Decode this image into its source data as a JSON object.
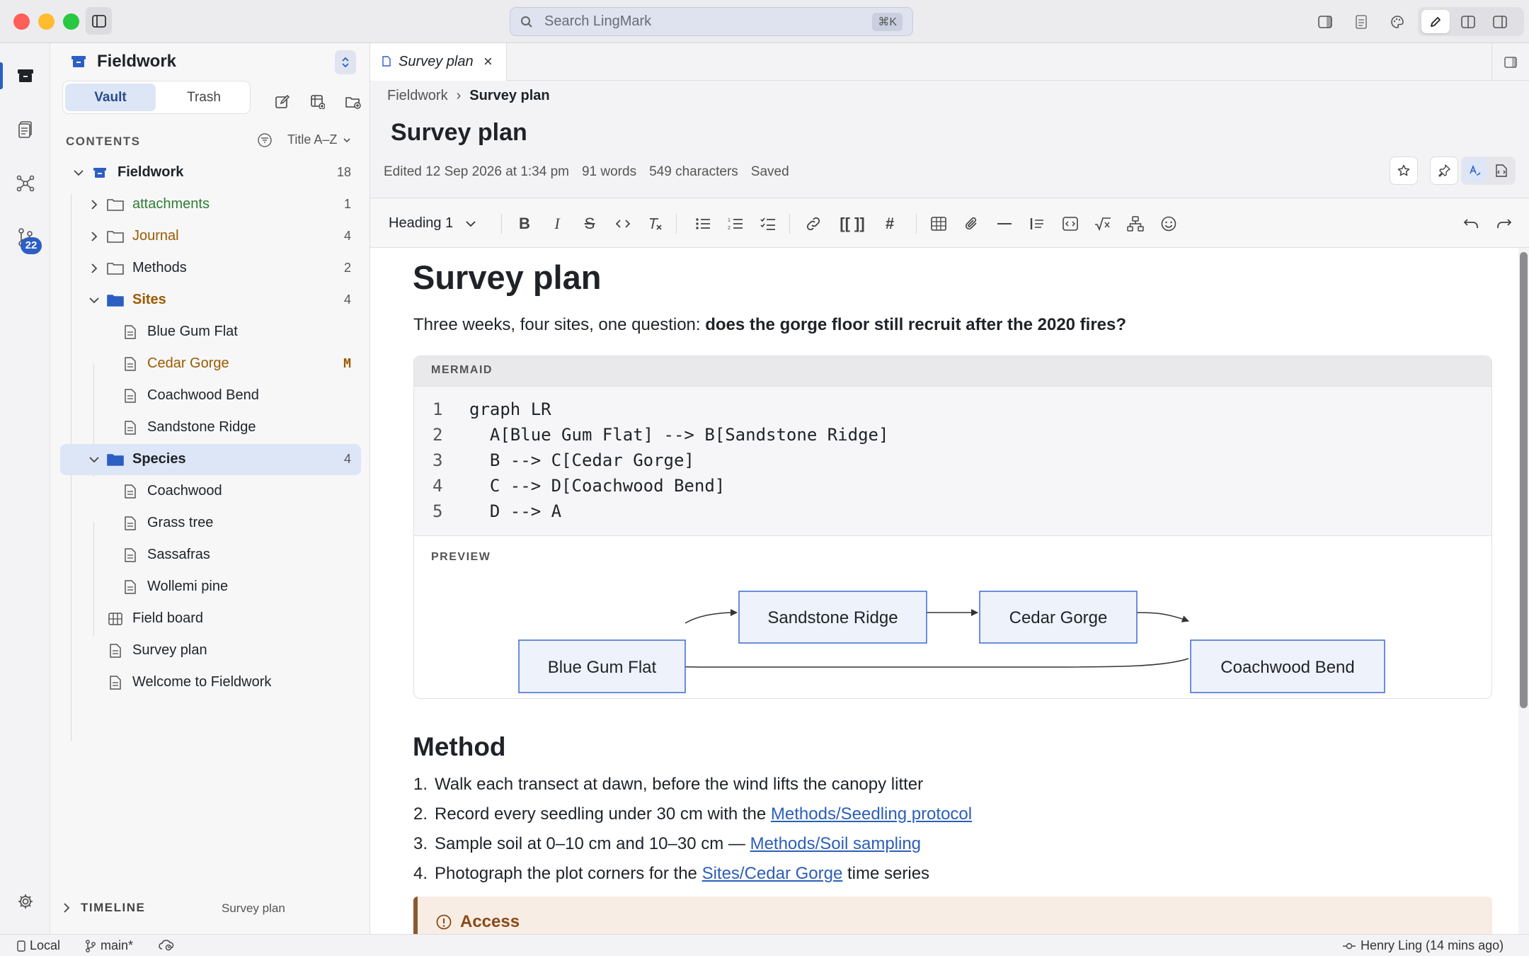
{
  "titlebar": {
    "search_placeholder": "Search LingMark",
    "search_shortcut": "⌘K"
  },
  "rail": {
    "changes_badge": "22"
  },
  "sidebar": {
    "vault_name": "Fieldwork",
    "segments": {
      "vault": "Vault",
      "trash": "Trash"
    },
    "contents_label": "CONTENTS",
    "sort_label": "Title A–Z",
    "tree": {
      "root": {
        "label": "Fieldwork",
        "count": "18"
      },
      "attachments": {
        "label": "attachments",
        "count": "1"
      },
      "journal": {
        "label": "Journal",
        "count": "4"
      },
      "methods": {
        "label": "Methods",
        "count": "2"
      },
      "sites": {
        "label": "Sites",
        "count": "4"
      },
      "blue_gum_flat": {
        "label": "Blue Gum Flat"
      },
      "cedar_gorge": {
        "label": "Cedar Gorge",
        "badge": "M"
      },
      "coachwood_bend": {
        "label": "Coachwood Bend"
      },
      "sandstone_ridge": {
        "label": "Sandstone Ridge"
      },
      "species": {
        "label": "Species",
        "count": "4"
      },
      "coachwood": {
        "label": "Coachwood"
      },
      "grass_tree": {
        "label": "Grass tree"
      },
      "sassafras": {
        "label": "Sassafras"
      },
      "wollemi_pine": {
        "label": "Wollemi pine"
      },
      "field_board": {
        "label": "Field board"
      },
      "survey_plan": {
        "label": "Survey plan"
      },
      "welcome": {
        "label": "Welcome to Fieldwork"
      }
    },
    "timeline_label": "TIMELINE",
    "timeline_file": "Survey plan"
  },
  "tab": {
    "label": "Survey plan",
    "close": "×"
  },
  "breadcrumb": {
    "root": "Fieldwork",
    "sep": "›",
    "current": "Survey plan"
  },
  "doc": {
    "title": "Survey plan",
    "meta": {
      "edited": "Edited 12 Sep 2026 at 1:34 pm",
      "words": "91 words",
      "chars": "549 characters",
      "status": "Saved"
    }
  },
  "toolbar": {
    "heading_select": "Heading 1",
    "wikilink": "[[ ]]",
    "tag": "#"
  },
  "content": {
    "h1": "Survey plan",
    "intro_plain": "Three weeks, four sites, one question: ",
    "intro_bold": "does the gorge floor still recruit after the 2020 fires?",
    "mermaid_label": "MERMAID",
    "code": [
      {
        "n": "1",
        "text": "graph LR"
      },
      {
        "n": "2",
        "text": "  A[Blue Gum Flat] --> B[Sandstone Ridge]"
      },
      {
        "n": "3",
        "text": "  B --> C[Cedar Gorge]"
      },
      {
        "n": "4",
        "text": "  C --> D[Coachwood Bend]"
      },
      {
        "n": "5",
        "text": "  D --> A"
      }
    ],
    "preview_label": "PREVIEW",
    "nodes": {
      "a": "Blue Gum Flat",
      "b": "Sandstone Ridge",
      "c": "Cedar Gorge",
      "d": "Coachwood Bend"
    },
    "method_heading": "Method",
    "steps": [
      {
        "n": "1.",
        "text": "Walk each transect at dawn, before the wind lifts the canopy litter"
      },
      {
        "n": "2.",
        "text": "Record every seedling under 30 cm with the ",
        "link": "Methods/Seedling protocol"
      },
      {
        "n": "3.",
        "text": "Sample soil at 0–10 cm and 10–30 cm — ",
        "link": "Methods/Soil sampling"
      },
      {
        "n": "4.",
        "text": "Photograph the plot corners for the ",
        "link": "Sites/Cedar Gorge",
        "after": " time series"
      }
    ],
    "callout_title": "Access"
  },
  "statusbar": {
    "location": "Local",
    "branch": "main*",
    "author": "Henry Ling (14 mins ago)"
  }
}
